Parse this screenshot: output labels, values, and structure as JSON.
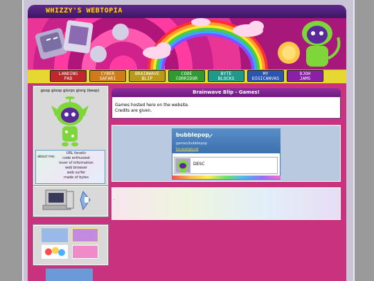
{
  "site": {
    "title": "WHIZZY'S WEBTOPIA"
  },
  "nav": [
    {
      "label": "LANDING\nPAD",
      "color": "#c0262e"
    },
    {
      "label": "CYBER\nSAFARI",
      "color": "#d07a18"
    },
    {
      "label": "BRAINWAVE\nBLIP",
      "color": "#b89a18"
    },
    {
      "label": "CODE\nCORRIDOR",
      "color": "#2f9a2f"
    },
    {
      "label": "BYTE\nBLOCKS",
      "color": "#1f9a8a"
    },
    {
      "label": "MY\nDIGICANVAS",
      "color": "#2a55b0"
    },
    {
      "label": "DJOH\nJAMS",
      "color": "#8a1fa8"
    }
  ],
  "sidebar": {
    "greeting": "goop gloop glorps glorg (beep)",
    "about_label": "about me:",
    "about_lines": [
      "URL fanatic",
      "code enthusiast",
      "lover of information",
      "web browser",
      "web surfer",
      "made of bytes"
    ]
  },
  "main": {
    "heading": "Brainwave Blip - Games!",
    "intro_lines": [
      "Games hosted here on the website.",
      "Credits are given."
    ],
    "game": {
      "title": "bubblepop",
      "path": "games/bubblepop",
      "link": "fun.example.ext",
      "desc": "DESC"
    },
    "bottom_text": "."
  }
}
